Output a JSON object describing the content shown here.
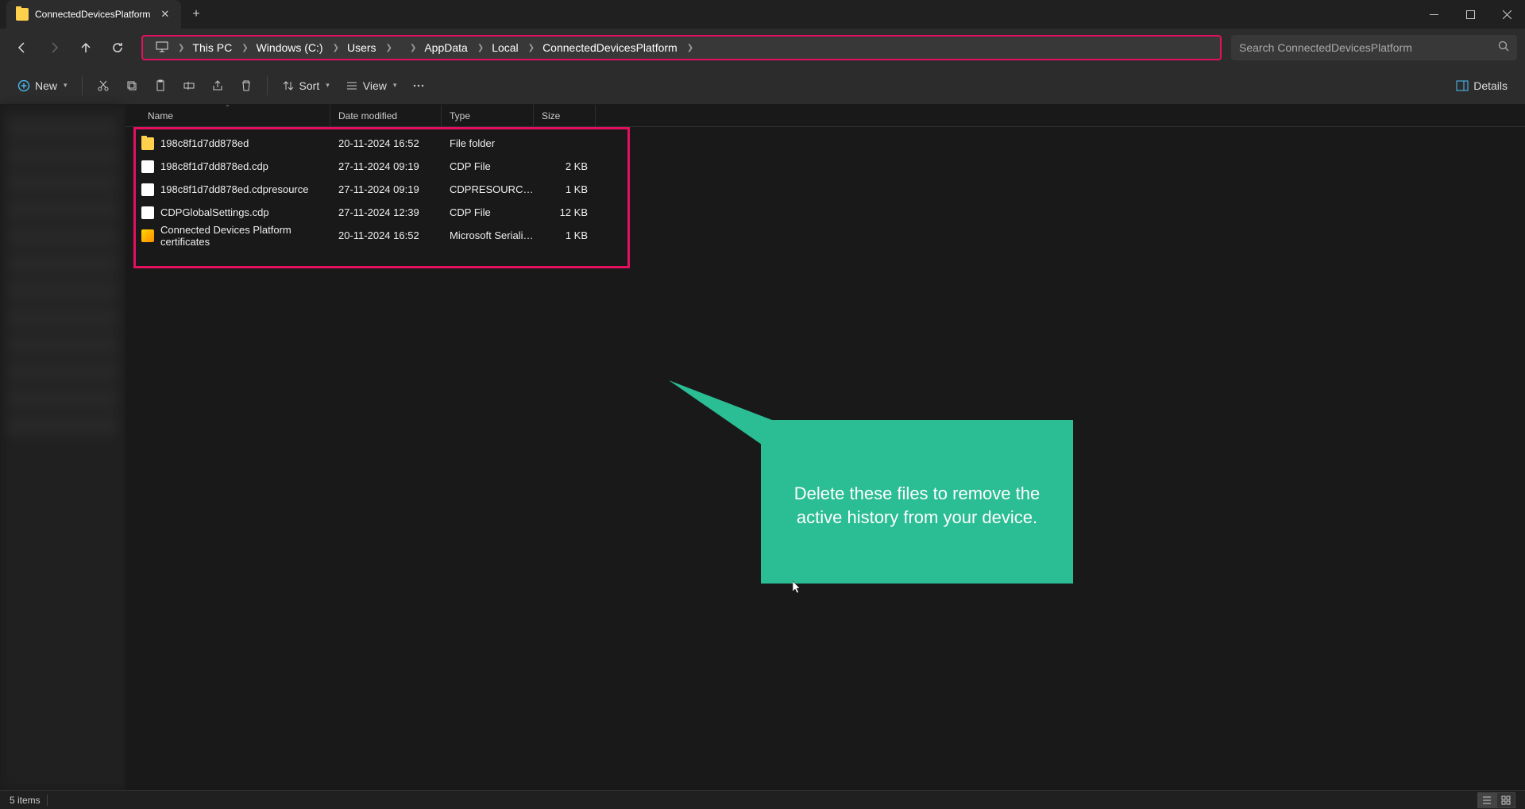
{
  "tab": {
    "title": "ConnectedDevicesPlatform"
  },
  "breadcrumb": [
    {
      "label": "This PC"
    },
    {
      "label": "Windows (C:)"
    },
    {
      "label": "Users"
    },
    {
      "label": "",
      "redacted": true
    },
    {
      "label": "AppData"
    },
    {
      "label": "Local"
    },
    {
      "label": "ConnectedDevicesPlatform"
    }
  ],
  "search": {
    "placeholder": "Search ConnectedDevicesPlatform"
  },
  "toolbar": {
    "new_label": "New",
    "sort_label": "Sort",
    "view_label": "View",
    "details_label": "Details"
  },
  "columns": {
    "name": "Name",
    "date": "Date modified",
    "type": "Type",
    "size": "Size"
  },
  "files": [
    {
      "icon": "folder",
      "name": "198c8f1d7dd878ed",
      "date": "20-11-2024 16:52",
      "type": "File folder",
      "size": ""
    },
    {
      "icon": "file",
      "name": "198c8f1d7dd878ed.cdp",
      "date": "27-11-2024 09:19",
      "type": "CDP File",
      "size": "2 KB"
    },
    {
      "icon": "file",
      "name": "198c8f1d7dd878ed.cdpresource",
      "date": "27-11-2024 09:19",
      "type": "CDPRESOURCE File",
      "size": "1 KB"
    },
    {
      "icon": "file",
      "name": "CDPGlobalSettings.cdp",
      "date": "27-11-2024 12:39",
      "type": "CDP File",
      "size": "12 KB"
    },
    {
      "icon": "cert",
      "name": "Connected Devices Platform certificates",
      "date": "20-11-2024 16:52",
      "type": "Microsoft Serialise...",
      "size": "1 KB"
    }
  ],
  "status": {
    "items_text": "5 items"
  },
  "callout": {
    "text": "Delete these files to remove the active history from your device."
  }
}
